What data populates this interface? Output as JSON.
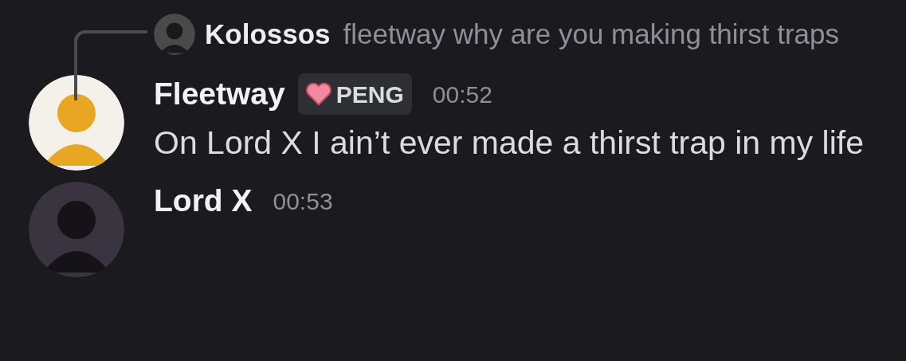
{
  "reply": {
    "author": "Kolossos",
    "text": "fleetway why are you making thirst traps"
  },
  "messages": [
    {
      "author": "Fleetway",
      "badge": "PENG",
      "time": "00:52",
      "text": "On Lord X I ain’t ever made a thirst trap in my life",
      "color": "#f4f1ea"
    },
    {
      "author": "Lord X",
      "time": "00:53",
      "color": "#3a3340"
    }
  ]
}
